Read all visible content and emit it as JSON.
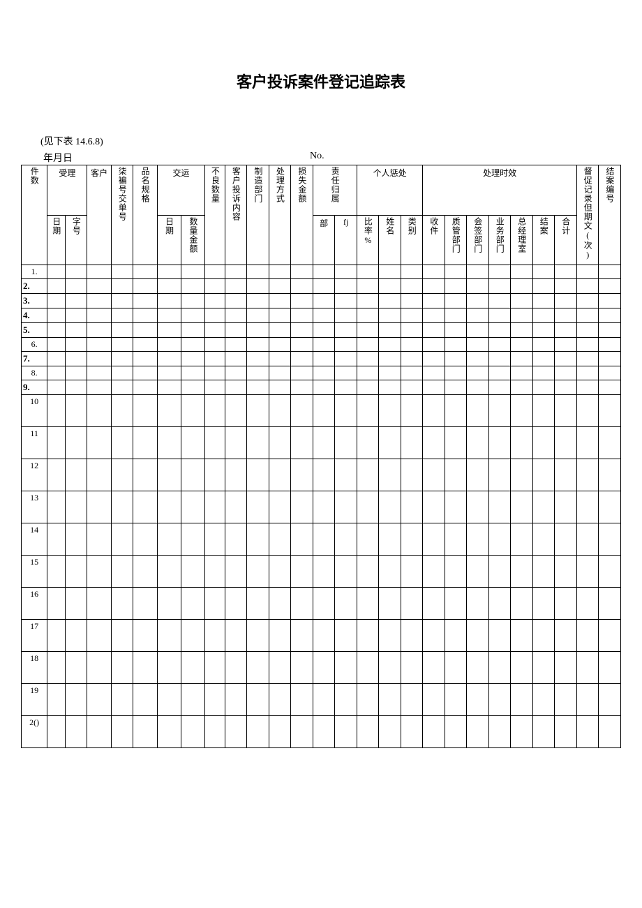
{
  "title": "客户投诉案件登记追踪表",
  "note": "(见下表 14.6.8)",
  "date_label": "年月日",
  "no_label": "No.",
  "headers": {
    "col_num": "件数",
    "accept": "受理",
    "customer": "客户",
    "order_no": "柒褊号交单号",
    "product": "品名规格",
    "shipping": "交运",
    "ship_date": "日期",
    "ship_qty": "数量金额",
    "bad_qty": "不良数量",
    "complaint": "客户投诉内容",
    "mfg_dept": "制造部门",
    "method": "处理方式",
    "loss": "损失金额",
    "resp": "责任归属",
    "resp_dept": "部",
    "resp_fj": "fj",
    "punish": "个人惩处",
    "punish_rate": "比率%",
    "punish_name": "姓名",
    "punish_type": "类别",
    "timing": "处理时效",
    "t_recv": "收件",
    "t_qc": "质管部门",
    "t_sign": "会签部门",
    "t_biz": "业务部门",
    "t_gm": "总经理室",
    "t_close": "结案",
    "t_total": "合计",
    "urge": "督促记录但期文(次)",
    "close_no": "结案编号",
    "accept_date": "日期",
    "accept_no": "字号"
  },
  "rows": [
    {
      "n": "1.",
      "style": "normal-num",
      "h": "s"
    },
    {
      "n": "2.",
      "style": "bold",
      "h": "s"
    },
    {
      "n": "3.",
      "style": "bold",
      "h": "s"
    },
    {
      "n": "4.",
      "style": "bold",
      "h": "s"
    },
    {
      "n": "5.",
      "style": "bold",
      "h": "s"
    },
    {
      "n": "6.",
      "style": "normal-num",
      "h": "s"
    },
    {
      "n": "7.",
      "style": "bold",
      "h": "s"
    },
    {
      "n": "8.",
      "style": "normal-num",
      "h": "s"
    },
    {
      "n": "9.",
      "style": "bold",
      "h": "s"
    },
    {
      "n": "10",
      "style": "normal-num",
      "h": "l"
    },
    {
      "n": "11",
      "style": "normal-num",
      "h": "l"
    },
    {
      "n": "12",
      "style": "normal-num",
      "h": "l"
    },
    {
      "n": "13",
      "style": "normal-num",
      "h": "l"
    },
    {
      "n": "14",
      "style": "normal-num",
      "h": "l"
    },
    {
      "n": "15",
      "style": "normal-num",
      "h": "l"
    },
    {
      "n": "16",
      "style": "normal-num",
      "h": "l"
    },
    {
      "n": "17",
      "style": "normal-num",
      "h": "l"
    },
    {
      "n": "18",
      "style": "normal-num",
      "h": "l"
    },
    {
      "n": "19",
      "style": "normal-num",
      "h": "l"
    },
    {
      "n": "2()",
      "style": "normal-num",
      "h": "l"
    }
  ]
}
